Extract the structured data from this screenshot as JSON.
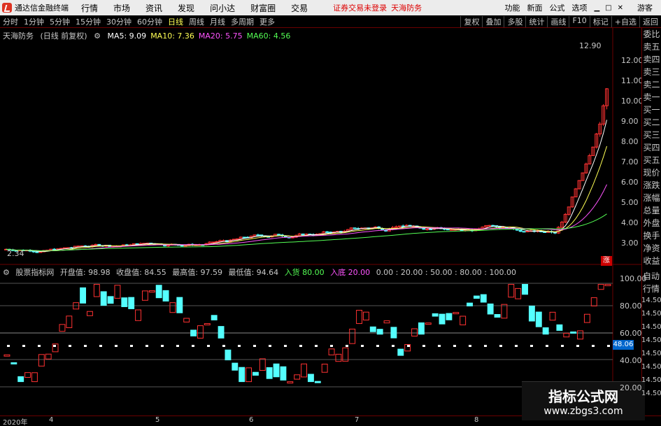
{
  "app": {
    "title": "通达信金融终端",
    "warning": "证券交易未登录",
    "stock_short": "天海防务"
  },
  "menu": [
    "行情",
    "市场",
    "资讯",
    "发现",
    "问小达",
    "财富圈",
    "交易"
  ],
  "topright": [
    "功能",
    "新面",
    "公式",
    "选项"
  ],
  "guest": "游客",
  "periods": [
    "分时",
    "1分钟",
    "5分钟",
    "15分钟",
    "30分钟",
    "60分钟",
    "日线",
    "周线",
    "月线",
    "多周期",
    "更多"
  ],
  "active_period": "日线",
  "toolbar_right": [
    "复权",
    "叠加",
    "多股",
    "统计",
    "画线",
    "F10",
    "标记",
    "+自选",
    "返回"
  ],
  "stock_info": {
    "name": "天海防务",
    "mode": "(日线 前复权)",
    "ma": [
      {
        "label": "MA5: 9.09",
        "color": "#ffffff"
      },
      {
        "label": "MA10: 7.36",
        "color": "#ffff54"
      },
      {
        "label": "MA20: 5.75",
        "color": "#ff54ff"
      },
      {
        "label": "MA60: 4.56",
        "color": "#54ff54"
      }
    ]
  },
  "price_axis": [
    "12.00",
    "11.00",
    "10.00",
    "9.00",
    "8.00",
    "7.00",
    "6.00",
    "5.00",
    "4.00",
    "3.00"
  ],
  "price_labels": {
    "high": "12.90",
    "low": "2.34"
  },
  "tag_zhang": "涨",
  "sidebar": [
    "委比",
    "卖五",
    "卖四",
    "卖三",
    "卖二",
    "卖一",
    "买一",
    "买二",
    "买三",
    "买四",
    "买五",
    "现价",
    "涨跌",
    "涨幅",
    "总量",
    "外盘",
    "换手",
    "净资",
    "收益"
  ],
  "sidebar2": [
    "自动",
    "行情"
  ],
  "indicator": {
    "name": "股票指标网",
    "values": [
      "开盘值: 98.98",
      "收盘值: 84.55",
      "最高值: 97.59",
      "最低值: 94.64"
    ],
    "buy_in": "入货 80.00",
    "buy_bottom": "入底 20.00",
    "rest": "0.00 : 20.00 : 50.00 : 80.00 : 100.00"
  },
  "ind_axis": [
    "100.00",
    "80.00",
    "60.00",
    "40.00",
    "20.00"
  ],
  "ind_side": [
    "14.50",
    "14.50",
    "14.50",
    "14.50",
    "14.50",
    "14.50",
    "14.50",
    "14.50"
  ],
  "ind_badge": "48.06",
  "dates": [
    {
      "label": "2020年"
    },
    {
      "label": "4"
    },
    {
      "label": "5"
    },
    {
      "label": "6"
    },
    {
      "label": "7"
    },
    {
      "label": "8"
    }
  ],
  "watermark": {
    "line1": "指标公式网",
    "line2": "www.zbgs3.com"
  }
}
